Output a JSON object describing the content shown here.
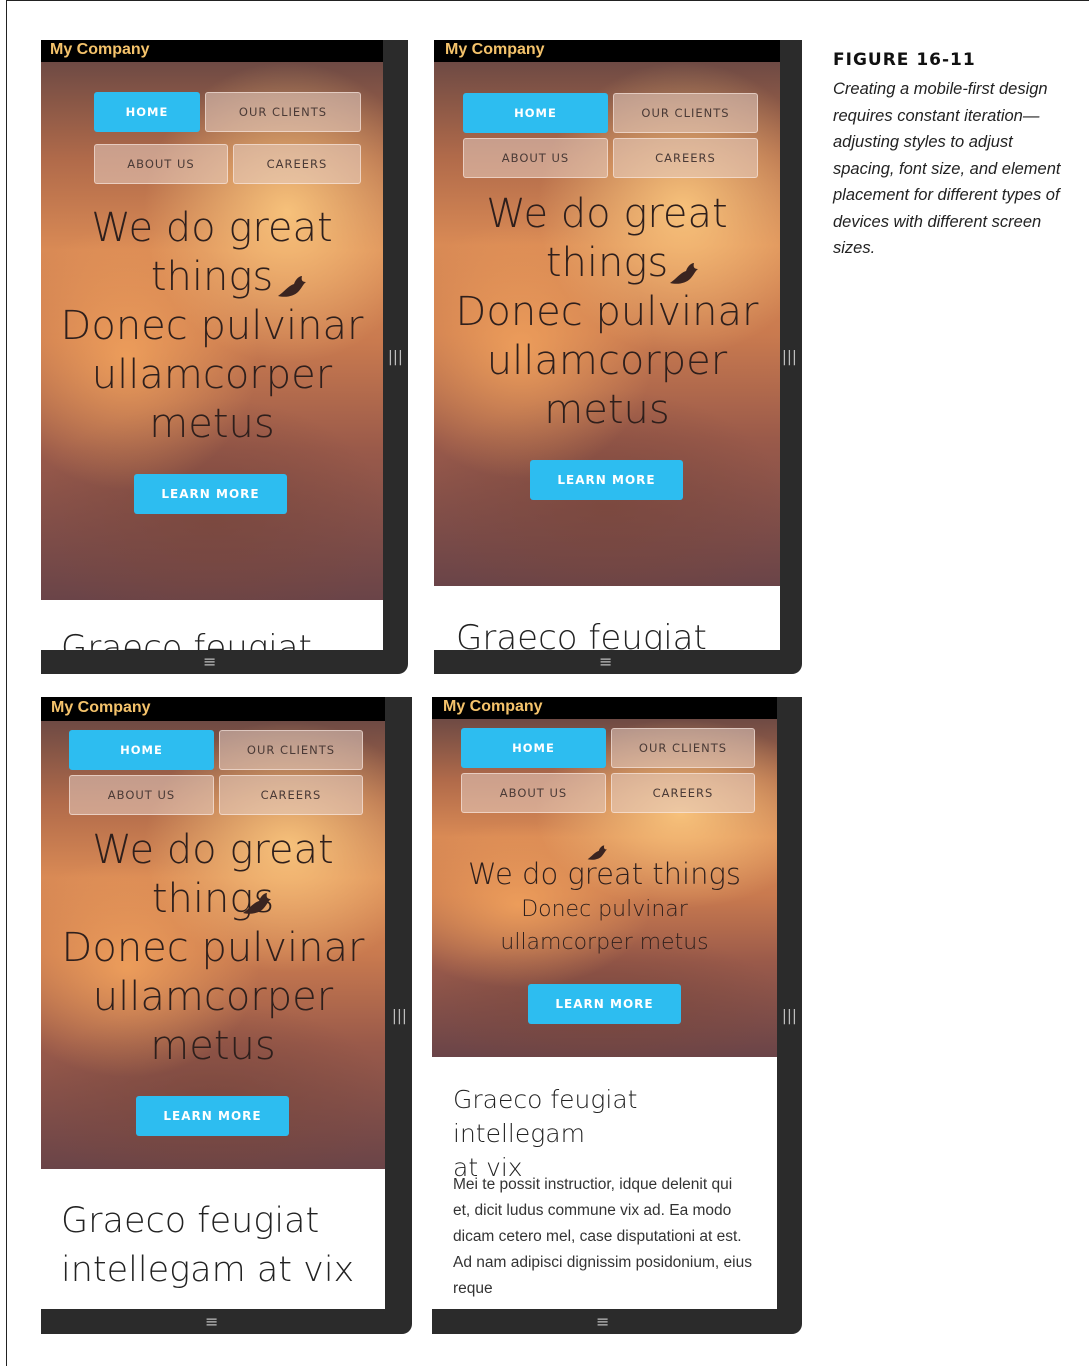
{
  "caption": {
    "figure_label": "FIGURE 16-11",
    "text": "Creating a mobile-first design requires constant iteration—adjusting styles to adjust spacing, font size, and element placement for different types of devices with different screen sizes."
  },
  "site": {
    "brand": "My Company",
    "nav": {
      "home": "HOME",
      "clients": "OUR CLIENTS",
      "about": "ABOUT US",
      "careers": "CAREERS"
    },
    "headline_line1": "We do great things",
    "headline_line2": "Donec pulvinar ullamcorper metus",
    "headline_a": "We do great",
    "headline_b": "things",
    "headline_c": "Donec pulvinar",
    "headline_d": "ullamcorper",
    "headline_e": "metus",
    "headline_ltop": "We do great things",
    "headline_lmid": "Donec pulvinar",
    "headline_lbot": "ullamcorper metus",
    "cta": "LEARN MORE",
    "section_title_full": "Graeco feugiat intellegam at vix",
    "section_title_l1": "Graeco feugiat",
    "section_title_l2": "intellegam at vix",
    "section_title_w1": "Graeco feugiat intellegam",
    "section_title_w2": "at vix",
    "section_body": "Mei te possit instructior, idque delenit qui et, dicit ludus commune vix ad. Ea modo dicam cetero mel, case disputationi at est. Ad nam adipisci dignissim posidonium, eius reque"
  },
  "icons": {
    "side_grip": "vertical-grip-icon",
    "bottom_grip": "horizontal-grip-icon",
    "bird": "bird-silhouette-icon"
  },
  "colors": {
    "accent": "#2dbdf0",
    "brand_text": "#f5c36b",
    "device_frame": "#2b2b2b"
  }
}
